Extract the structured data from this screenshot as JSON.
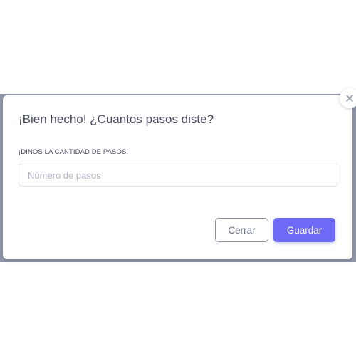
{
  "modal": {
    "title": "¡Bien hecho! ¿Cuantos pasos diste?",
    "field_label": "¡DINOS LA CANTIDAD DE PASOS!",
    "steps_input": {
      "value": "",
      "placeholder": "Número de pasos"
    },
    "cancel_label": "Cerrar",
    "save_label": "Guardar",
    "close_icon": "close-icon"
  },
  "colors": {
    "overlay": "#8f96a8",
    "accent": "#6d6af7",
    "text": "#454b5c",
    "placeholder": "#aeb2c0"
  }
}
